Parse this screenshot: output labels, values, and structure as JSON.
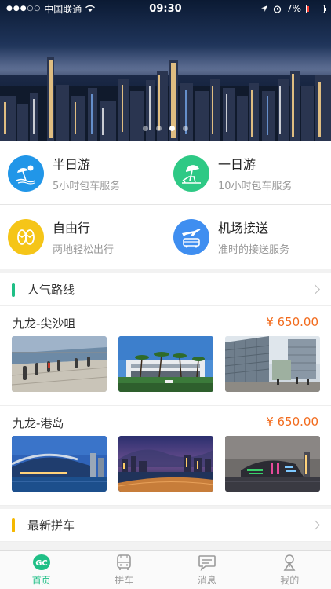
{
  "status_bar": {
    "carrier": "中国联通",
    "time": "09:30",
    "battery": "7%"
  },
  "banner": {
    "page_count": 4,
    "active_page": 3
  },
  "services": [
    {
      "title": "半日游",
      "subtitle": "5小时包车服务",
      "icon": "beach-umbrella-icon",
      "color": "#2196e8"
    },
    {
      "title": "一日游",
      "subtitle": "10小时包车服务",
      "icon": "parasol-chair-icon",
      "color": "#2ec985"
    },
    {
      "title": "自由行",
      "subtitle": "两地轻松出行",
      "icon": "sandals-icon",
      "color": "#f5c518"
    },
    {
      "title": "机场接送",
      "subtitle": "准时的接送服务",
      "icon": "plane-bus-icon",
      "color": "#3f8ef0"
    }
  ],
  "popular_routes": {
    "title": "人气路线",
    "accent": "#1fbf86",
    "routes": [
      {
        "name": "九龙-尖沙咀",
        "price": "¥ 650.00"
      },
      {
        "name": "九龙-港岛",
        "price": "¥ 650.00"
      }
    ]
  },
  "latest_carpool": {
    "title": "最新拼车",
    "accent": "#f5b800"
  },
  "tabbar": {
    "active_color": "#1fbf86",
    "items": [
      {
        "label": "首页",
        "icon": "home-gc-icon"
      },
      {
        "label": "拼车",
        "icon": "bus-icon"
      },
      {
        "label": "消息",
        "icon": "message-icon"
      },
      {
        "label": "我的",
        "icon": "profile-icon"
      }
    ]
  }
}
